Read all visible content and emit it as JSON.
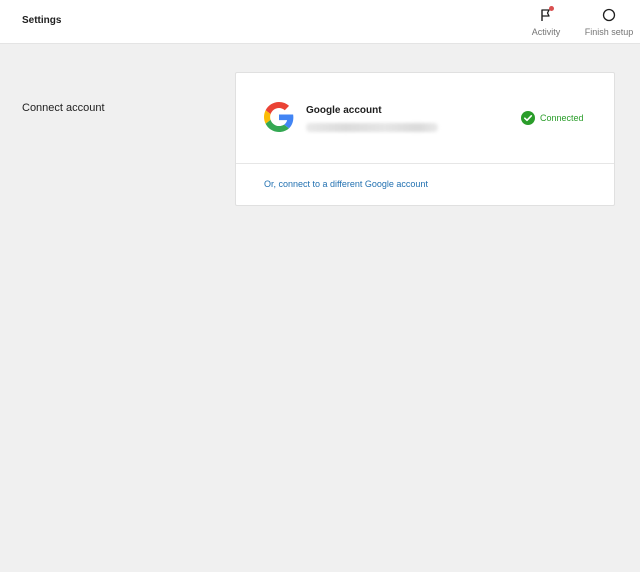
{
  "header": {
    "title": "Settings",
    "actions": [
      {
        "label": "Activity",
        "icon": "activity-flag-icon"
      },
      {
        "label": "Finish setup",
        "icon": "progress-circle-icon"
      }
    ]
  },
  "section": {
    "label": "Connect account"
  },
  "account_card": {
    "service_icon": "google-logo-icon",
    "account_title": "Google account",
    "account_email": "",
    "status_icon": "check-circle-icon",
    "status_label": "Connected",
    "link_label": "Or, connect to a different Google account"
  },
  "colors": {
    "background": "#f0f0f0",
    "card": "#ffffff",
    "status_green": "#2a9d2a",
    "link_blue": "#2271b1",
    "notification_red": "#d94f4f"
  }
}
